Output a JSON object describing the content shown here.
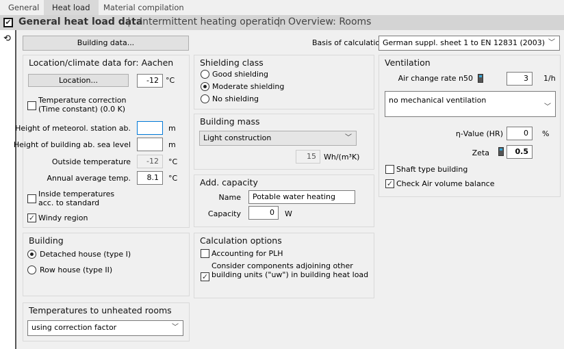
{
  "tabs": [
    "General",
    "Heat load",
    "Material compilation"
  ],
  "subnav": {
    "checked": true,
    "items": [
      "General heat load data",
      "Intermittent heating operation",
      "Overview: Rooms"
    ]
  },
  "building_data_button": "Building data...",
  "basis": {
    "label": "Basis of calculation",
    "value": "German suppl. sheet 1 to EN 12831 (2003)"
  },
  "location": {
    "title": "Location/climate data for: Aachen",
    "button": "Location...",
    "temp": "-12",
    "temp_unit": "°C",
    "temp_correction": {
      "label1": "Temperature correction",
      "label2": "(Time constant) (0.0 K)",
      "checked": false
    },
    "station_height": {
      "label": "Height of meteorol. station ab.",
      "value": "",
      "unit": "m"
    },
    "building_height": {
      "label": "Height of building ab. sea level",
      "value": "",
      "unit": "m"
    },
    "outside_temp": {
      "label": "Outside temperature",
      "value": "-12",
      "unit": "°C"
    },
    "annual_temp": {
      "label": "Annual average temp.",
      "value": "8.1",
      "unit": "°C"
    },
    "inside_temps": {
      "label1": "Inside temperatures",
      "label2": "acc. to standard",
      "checked": false
    },
    "windy": {
      "label": "Windy region",
      "checked": true
    }
  },
  "shielding": {
    "title": "Shielding class",
    "options": [
      "Good shielding",
      "Moderate shielding",
      "No shielding"
    ],
    "selected": 1
  },
  "mass": {
    "title": "Building mass",
    "value": "Light construction",
    "num": "15",
    "unit": "Wh/(m³K)"
  },
  "capacity": {
    "title": "Add. capacity",
    "name_label": "Name",
    "name_value": "Potable water heating",
    "cap_label": "Capacity",
    "cap_value": "0",
    "cap_unit": "W"
  },
  "building": {
    "title": "Building",
    "options": [
      "Detached house (type I)",
      "Row house (type II)"
    ],
    "selected": 0
  },
  "calc": {
    "title": "Calculation options",
    "plh": {
      "label": "Accounting for PLH",
      "checked": false
    },
    "uw": {
      "label1": "Consider components adjoining other",
      "label2": "building units (\"uw\") in building heat load",
      "checked": true
    }
  },
  "unheated": {
    "title": "Temperatures to unheated rooms",
    "value": "using correction factor"
  },
  "ventilation": {
    "title": "Ventilation",
    "n50_label": "Air change rate n50",
    "n50": "3",
    "n50_unit": "1/h",
    "mode": "no mechanical ventilation",
    "eta_label": "η-Value (HR)",
    "eta": "0",
    "eta_unit": "%",
    "zeta_label": "Zeta",
    "zeta": "0.5",
    "shaft": {
      "label": "Shaft type building",
      "checked": false
    },
    "balance": {
      "label": "Check Air volume balance",
      "checked": true
    }
  }
}
